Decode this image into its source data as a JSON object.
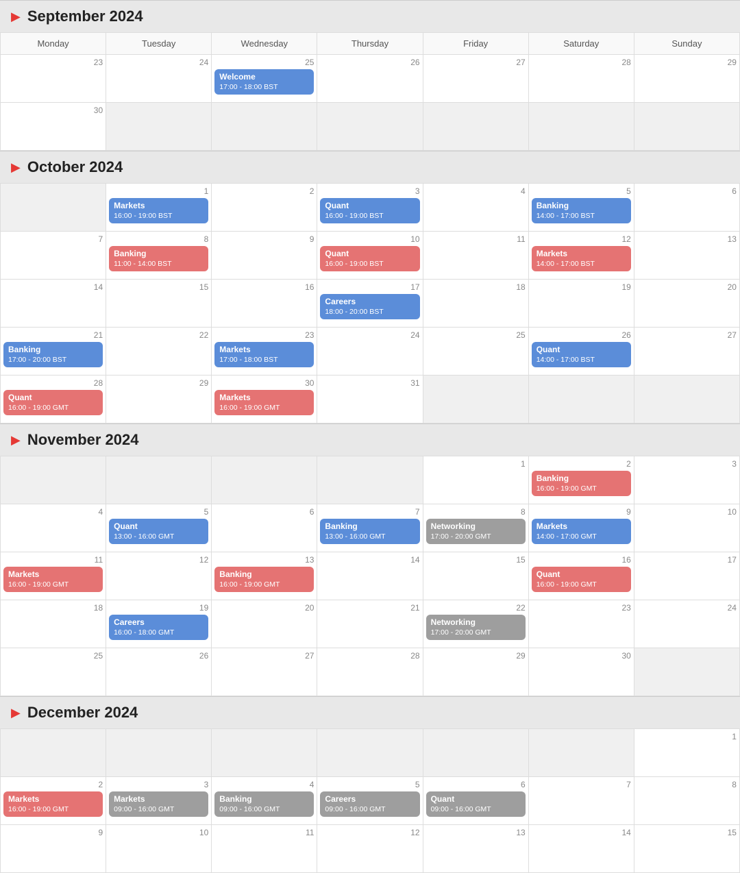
{
  "months": [
    {
      "name": "September 2024",
      "dayHeaders": [
        "Monday",
        "Tuesday",
        "Wednesday",
        "Thursday",
        "Friday",
        "Saturday",
        "Sunday"
      ],
      "weeks": [
        [
          {
            "num": "23",
            "events": [],
            "shade": false
          },
          {
            "num": "24",
            "events": [],
            "shade": false
          },
          {
            "num": "25",
            "events": [
              {
                "title": "Welcome",
                "time": "17:00 - 18:00 BST",
                "color": "blue"
              }
            ],
            "shade": false
          },
          {
            "num": "26",
            "events": [],
            "shade": false
          },
          {
            "num": "27",
            "events": [],
            "shade": false
          },
          {
            "num": "28",
            "events": [],
            "shade": false
          },
          {
            "num": "29",
            "events": [],
            "shade": false
          }
        ],
        [
          {
            "num": "30",
            "events": [],
            "shade": false
          },
          {
            "num": "",
            "events": [],
            "shade": true
          },
          {
            "num": "",
            "events": [],
            "shade": true
          },
          {
            "num": "",
            "events": [],
            "shade": true
          },
          {
            "num": "",
            "events": [],
            "shade": true
          },
          {
            "num": "",
            "events": [],
            "shade": true
          },
          {
            "num": "",
            "events": [],
            "shade": true
          }
        ]
      ]
    },
    {
      "name": "October 2024",
      "dayHeaders": [],
      "weeks": [
        [
          {
            "num": "",
            "events": [],
            "shade": true
          },
          {
            "num": "1",
            "events": [
              {
                "title": "Markets",
                "time": "16:00 - 19:00 BST",
                "color": "blue"
              }
            ],
            "shade": false
          },
          {
            "num": "2",
            "events": [],
            "shade": false
          },
          {
            "num": "3",
            "events": [
              {
                "title": "Quant",
                "time": "16:00 - 19:00 BST",
                "color": "blue"
              }
            ],
            "shade": false
          },
          {
            "num": "4",
            "events": [],
            "shade": false
          },
          {
            "num": "5",
            "events": [
              {
                "title": "Banking",
                "time": "14:00 - 17:00 BST",
                "color": "blue"
              }
            ],
            "shade": false
          },
          {
            "num": "6",
            "events": [],
            "shade": false
          }
        ],
        [
          {
            "num": "7",
            "events": [],
            "shade": false
          },
          {
            "num": "8",
            "events": [
              {
                "title": "Banking",
                "time": "11:00 - 14:00 BST",
                "color": "red"
              }
            ],
            "shade": false
          },
          {
            "num": "9",
            "events": [],
            "shade": false
          },
          {
            "num": "10",
            "events": [
              {
                "title": "Quant",
                "time": "16:00 - 19:00 BST",
                "color": "red"
              }
            ],
            "shade": false
          },
          {
            "num": "11",
            "events": [],
            "shade": false
          },
          {
            "num": "12",
            "events": [
              {
                "title": "Markets",
                "time": "14:00 - 17:00 BST",
                "color": "red"
              }
            ],
            "shade": false
          },
          {
            "num": "13",
            "events": [],
            "shade": false
          }
        ],
        [
          {
            "num": "14",
            "events": [],
            "shade": false
          },
          {
            "num": "15",
            "events": [],
            "shade": false
          },
          {
            "num": "16",
            "events": [],
            "shade": false
          },
          {
            "num": "17",
            "events": [
              {
                "title": "Careers",
                "time": "18:00 - 20:00 BST",
                "color": "blue"
              }
            ],
            "shade": false
          },
          {
            "num": "18",
            "events": [],
            "shade": false
          },
          {
            "num": "19",
            "events": [],
            "shade": false
          },
          {
            "num": "20",
            "events": [],
            "shade": false
          }
        ],
        [
          {
            "num": "21",
            "events": [
              {
                "title": "Banking",
                "time": "17:00 - 20:00 BST",
                "color": "blue"
              }
            ],
            "shade": false
          },
          {
            "num": "22",
            "events": [],
            "shade": false
          },
          {
            "num": "23",
            "events": [
              {
                "title": "Markets",
                "time": "17:00 - 18:00 BST",
                "color": "blue"
              }
            ],
            "shade": false
          },
          {
            "num": "24",
            "events": [],
            "shade": false
          },
          {
            "num": "25",
            "events": [],
            "shade": false
          },
          {
            "num": "26",
            "events": [
              {
                "title": "Quant",
                "time": "14:00 - 17:00 BST",
                "color": "blue"
              }
            ],
            "shade": false
          },
          {
            "num": "27",
            "events": [],
            "shade": false
          }
        ],
        [
          {
            "num": "28",
            "events": [
              {
                "title": "Quant",
                "time": "16:00 - 19:00 GMT",
                "color": "red"
              }
            ],
            "shade": false
          },
          {
            "num": "29",
            "events": [],
            "shade": false
          },
          {
            "num": "30",
            "events": [
              {
                "title": "Markets",
                "time": "16:00 - 19:00 GMT",
                "color": "red"
              }
            ],
            "shade": false
          },
          {
            "num": "31",
            "events": [],
            "shade": false
          },
          {
            "num": "",
            "events": [],
            "shade": true
          },
          {
            "num": "",
            "events": [],
            "shade": true
          },
          {
            "num": "",
            "events": [],
            "shade": true
          }
        ]
      ]
    },
    {
      "name": "November 2024",
      "dayHeaders": [],
      "weeks": [
        [
          {
            "num": "",
            "events": [],
            "shade": true
          },
          {
            "num": "",
            "events": [],
            "shade": true
          },
          {
            "num": "",
            "events": [],
            "shade": true
          },
          {
            "num": "",
            "events": [],
            "shade": true
          },
          {
            "num": "1",
            "events": [],
            "shade": false
          },
          {
            "num": "2",
            "events": [
              {
                "title": "Banking",
                "time": "16:00 - 19:00 GMT",
                "color": "red"
              }
            ],
            "shade": false
          },
          {
            "num": "3",
            "events": [],
            "shade": false
          }
        ],
        [
          {
            "num": "4",
            "events": [],
            "shade": false
          },
          {
            "num": "5",
            "events": [
              {
                "title": "Quant",
                "time": "13:00 - 16:00 GMT",
                "color": "blue"
              }
            ],
            "shade": false
          },
          {
            "num": "6",
            "events": [],
            "shade": false
          },
          {
            "num": "7",
            "events": [
              {
                "title": "Banking",
                "time": "13:00 - 16:00 GMT",
                "color": "blue"
              }
            ],
            "shade": false
          },
          {
            "num": "8",
            "events": [
              {
                "title": "Networking",
                "time": "17:00 - 20:00 GMT",
                "color": "gray"
              }
            ],
            "shade": false
          },
          {
            "num": "9",
            "events": [
              {
                "title": "Markets",
                "time": "14:00 - 17:00 GMT",
                "color": "blue"
              }
            ],
            "shade": false
          },
          {
            "num": "10",
            "events": [],
            "shade": false
          }
        ],
        [
          {
            "num": "11",
            "events": [
              {
                "title": "Markets",
                "time": "16:00 - 19:00 GMT",
                "color": "red"
              }
            ],
            "shade": false
          },
          {
            "num": "12",
            "events": [],
            "shade": false
          },
          {
            "num": "13",
            "events": [
              {
                "title": "Banking",
                "time": "16:00 - 19:00 GMT",
                "color": "red"
              }
            ],
            "shade": false
          },
          {
            "num": "14",
            "events": [],
            "shade": false
          },
          {
            "num": "15",
            "events": [],
            "shade": false
          },
          {
            "num": "16",
            "events": [
              {
                "title": "Quant",
                "time": "16:00 - 19:00 GMT",
                "color": "red"
              }
            ],
            "shade": false
          },
          {
            "num": "17",
            "events": [],
            "shade": false
          }
        ],
        [
          {
            "num": "18",
            "events": [],
            "shade": false
          },
          {
            "num": "19",
            "events": [
              {
                "title": "Careers",
                "time": "16:00 - 18:00 GMT",
                "color": "blue"
              }
            ],
            "shade": false
          },
          {
            "num": "20",
            "events": [],
            "shade": false
          },
          {
            "num": "21",
            "events": [],
            "shade": false
          },
          {
            "num": "22",
            "events": [
              {
                "title": "Networking",
                "time": "17:00 - 20:00 GMT",
                "color": "gray"
              }
            ],
            "shade": false
          },
          {
            "num": "23",
            "events": [],
            "shade": false
          },
          {
            "num": "24",
            "events": [],
            "shade": false
          }
        ],
        [
          {
            "num": "25",
            "events": [],
            "shade": false
          },
          {
            "num": "26",
            "events": [],
            "shade": false
          },
          {
            "num": "27",
            "events": [],
            "shade": false
          },
          {
            "num": "28",
            "events": [],
            "shade": false
          },
          {
            "num": "29",
            "events": [],
            "shade": false
          },
          {
            "num": "30",
            "events": [],
            "shade": false
          },
          {
            "num": "",
            "events": [],
            "shade": true
          }
        ]
      ]
    },
    {
      "name": "December 2024",
      "dayHeaders": [],
      "weeks": [
        [
          {
            "num": "",
            "events": [],
            "shade": true
          },
          {
            "num": "",
            "events": [],
            "shade": true
          },
          {
            "num": "",
            "events": [],
            "shade": true
          },
          {
            "num": "",
            "events": [],
            "shade": true
          },
          {
            "num": "",
            "events": [],
            "shade": true
          },
          {
            "num": "",
            "events": [],
            "shade": true
          },
          {
            "num": "1",
            "events": [],
            "shade": false
          }
        ],
        [
          {
            "num": "2",
            "events": [
              {
                "title": "Markets",
                "time": "16:00 - 19:00 GMT",
                "color": "red"
              }
            ],
            "shade": false
          },
          {
            "num": "3",
            "events": [
              {
                "title": "Markets",
                "time": "09:00 - 16:00 GMT",
                "color": "gray"
              }
            ],
            "shade": false
          },
          {
            "num": "4",
            "events": [
              {
                "title": "Banking",
                "time": "09:00 - 16:00 GMT",
                "color": "gray"
              }
            ],
            "shade": false
          },
          {
            "num": "5",
            "events": [
              {
                "title": "Careers",
                "time": "09:00 - 16:00 GMT",
                "color": "gray"
              }
            ],
            "shade": false
          },
          {
            "num": "6",
            "events": [
              {
                "title": "Quant",
                "time": "09:00 - 16:00 GMT",
                "color": "gray"
              }
            ],
            "shade": false
          },
          {
            "num": "7",
            "events": [],
            "shade": false
          },
          {
            "num": "8",
            "events": [],
            "shade": false
          }
        ],
        [
          {
            "num": "9",
            "events": [],
            "shade": false
          },
          {
            "num": "10",
            "events": [],
            "shade": false
          },
          {
            "num": "11",
            "events": [],
            "shade": false
          },
          {
            "num": "12",
            "events": [],
            "shade": false
          },
          {
            "num": "13",
            "events": [],
            "shade": false
          },
          {
            "num": "14",
            "events": [],
            "shade": false
          },
          {
            "num": "15",
            "events": [],
            "shade": false
          }
        ]
      ]
    }
  ],
  "dayHeaders": [
    "Monday",
    "Tuesday",
    "Wednesday",
    "Thursday",
    "Friday",
    "Saturday",
    "Sunday"
  ]
}
